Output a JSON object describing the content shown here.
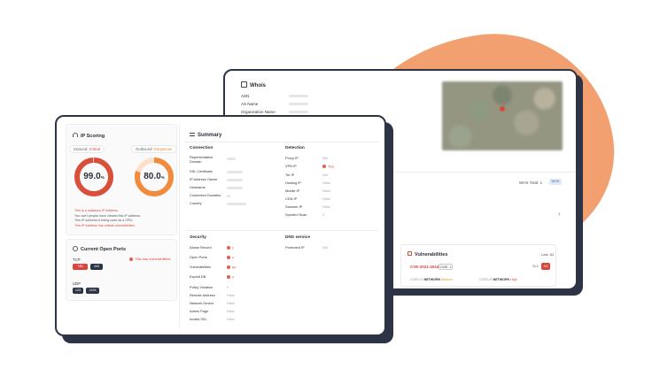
{
  "colors": {
    "accent": "#f2a06f",
    "frame": "#2d3446",
    "danger": "#d8453b",
    "gauge_in": "#d8503c",
    "gauge_out": "#f08a3c",
    "gauge_track_in": "#f6d2c8",
    "gauge_track_out": "#fbe1cb",
    "port_red": "#d8453b",
    "port_dark": "#2d3446"
  },
  "whois": {
    "title": "Whois",
    "rows": [
      "ASN",
      "AS Name",
      "Organization Name"
    ],
    "total_label": "WHS  Total: 1",
    "badge": "WHS"
  },
  "vulnerabilities": {
    "title": "Vulnerabilities",
    "count": "Last: 84",
    "cve": "CVE-2021-4044",
    "chip": "CWE: 1",
    "tag": "SLV",
    "severity": "9.8",
    "meta1_prefix": "CVSS v3",
    "meta1_bold": "NETWORK",
    "meta1_val": "Medium",
    "meta2_prefix": "CVSS v3",
    "meta2_bold": "NETWORK",
    "meta2_val": "High"
  },
  "ip_scoring": {
    "title": "IP Scoring",
    "inbound_label": "Inbound:",
    "inbound_state": "Critical",
    "outbound_label": "Outbound:",
    "outbound_state": "Dangerous",
    "inbound_score": 99.0,
    "outbound_score": 80.0,
    "inbound_text": "99.0",
    "outbound_text": "80.0",
    "unit": "%",
    "notes": [
      "This is a malicious IP Address.",
      "You can't people have viewed this IP address.",
      "This IP address is being used as a VPN.",
      "This IP Address has critical vulnerabilities."
    ]
  },
  "open_ports": {
    "title": "Current Open Ports",
    "tcp_label": "TCP",
    "udp_label": "UDP",
    "tcp_ports": [
      "780",
      "443"
    ],
    "udp_ports": [
      "123",
      "1194"
    ],
    "vuln_link": "This has vulnerabilities"
  },
  "summary": {
    "title": "Summary",
    "connection": {
      "title": "Connection",
      "labels": [
        "Representative Domain",
        "SSL Certificate",
        "IP Address Owner",
        "Hostname",
        "Connected Domains",
        "Country"
      ]
    },
    "detection": {
      "title": "Detection",
      "labels": [
        "Proxy IP",
        "VPN IP",
        "Tor IP",
        "Hosting IP",
        "Mobile IP",
        "CDN IP",
        "Scanner IP",
        "Spoofed Scan"
      ],
      "values": [
        "N/A",
        "True",
        "N/A",
        "False",
        "False",
        "False",
        "False",
        "0"
      ]
    },
    "security": {
      "title": "Security",
      "labels": [
        "Abuse Record",
        "Open Ports",
        "Vulnerabilities",
        "Exploit DB",
        "Policy Violation",
        "Remote Address",
        "Network Device",
        "Admin Page",
        "Invalid SSL"
      ],
      "values": [
        "2",
        "4",
        "84",
        "4",
        "0",
        "False",
        "False",
        "False",
        "False"
      ]
    },
    "dns": {
      "title": "DNS service",
      "labels": [
        "Promoted IP"
      ],
      "values": [
        "N/A"
      ]
    }
  }
}
